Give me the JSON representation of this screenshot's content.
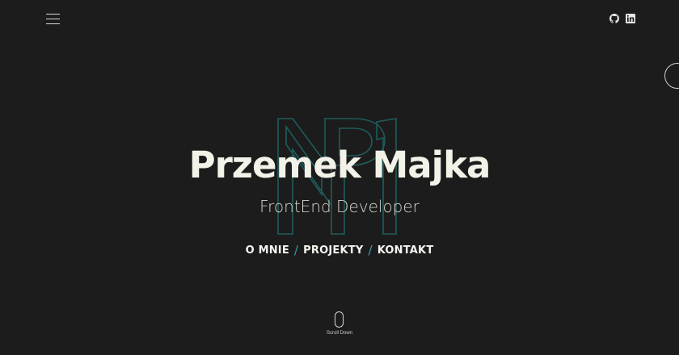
{
  "header": {
    "menu_icon": "hamburger-menu-icon",
    "socials": [
      {
        "icon": "github-icon"
      },
      {
        "icon": "linkedin-icon"
      }
    ]
  },
  "hero": {
    "logo_icon": "pm-monogram-logo",
    "name": "Przemek Majka",
    "role": "FrontEnd Developer"
  },
  "nav": {
    "links": [
      "O MNIE",
      "PROJEKTY",
      "KONTAKT"
    ],
    "separator": "/"
  },
  "scroll": {
    "icon": "mouse-scroll-icon",
    "label": "Scroll Down"
  },
  "colors": {
    "background": "#1c1c1c",
    "accent": "#3c9ca8",
    "logo_stroke": "#1f5c5a",
    "text": "#f2f2e8"
  }
}
